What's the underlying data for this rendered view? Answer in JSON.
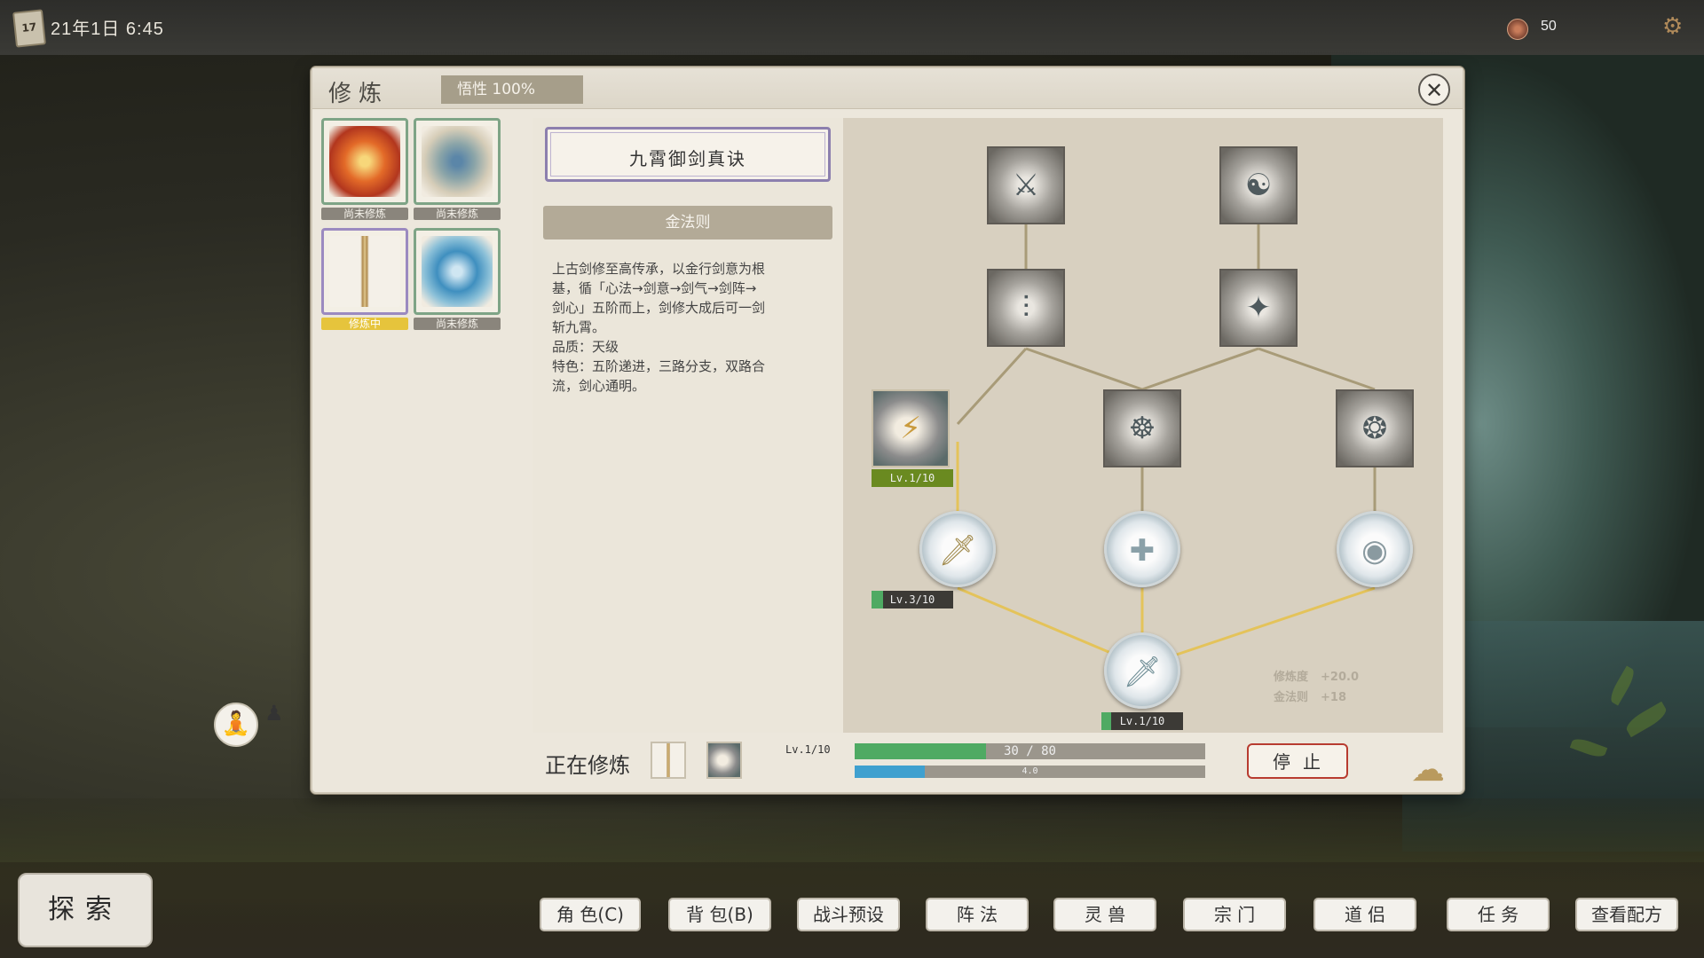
{
  "topbar": {
    "calendar_label": "17",
    "datetime": "21年1日  6:45",
    "currency_value": "50",
    "settings_icon": "gear-icon"
  },
  "panel": {
    "title": "修炼",
    "wisdom": "悟性   100%",
    "close_icon": "close-icon"
  },
  "skills": [
    {
      "name": "fire-scroll",
      "status": "尚未修炼",
      "active": false
    },
    {
      "name": "sword-jar",
      "status": "尚未修炼",
      "active": false
    },
    {
      "name": "sword-scroll",
      "status": "修炼中",
      "active": true
    },
    {
      "name": "ice-jar",
      "status": "尚未修炼",
      "active": false
    }
  ],
  "book": {
    "title": "九霄御剑真诀",
    "law": "金法则",
    "description": [
      "上古剑修至高传承，以金行剑意为根",
      "基，循「心法→剑意→剑气→剑阵→",
      "剑心」五阶而上，剑修大成后可一剑",
      "斩九霄。",
      "品质：天级",
      "特色：五阶递进，三路分支，双路合",
      "流，剑心通明。"
    ]
  },
  "tree": {
    "levels": [
      {
        "text": "Lv.1/10",
        "progress": 0.1
      },
      {
        "text": "Lv.3/10",
        "progress": 0.3
      },
      {
        "text": "Lv.1/10",
        "progress": 0.1
      }
    ],
    "bonus": [
      {
        "label": "修炼度",
        "value": "+20.0"
      },
      {
        "label": "金法则",
        "value": "+18"
      }
    ]
  },
  "training": {
    "label": "正在修炼",
    "level": "Lv.1/10",
    "exp_text": "30  /  80",
    "exp_progress": 0.375,
    "speed_text": "4.0",
    "speed_progress": 0.2,
    "stop_label": "停止"
  },
  "bottom": {
    "explore": "探索",
    "nav": [
      "角 色(C)",
      "背 包(B)",
      "战斗预设",
      "阵  法",
      "灵  兽",
      "宗  门",
      "道  侣",
      "任  务",
      "查看配方"
    ]
  },
  "colors": {
    "accent_green": "#4faa63",
    "accent_blue": "#3fa0cf",
    "stop_red": "#b83c30",
    "active_yellow": "#e6c43c"
  }
}
